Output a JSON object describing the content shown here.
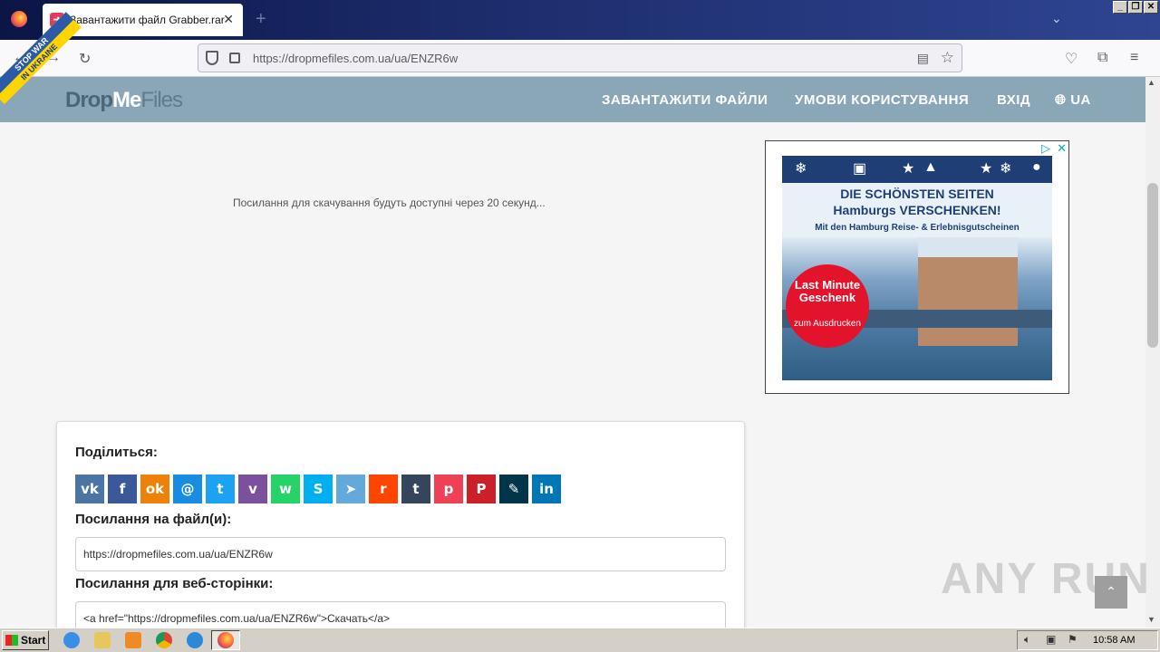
{
  "browser": {
    "tab_title": "Завантажити файл Grabber.rar",
    "new_tab": "+",
    "url_host": "https://dropmefiles.com.ua",
    "url_path": "/ua/ENZR6w"
  },
  "site": {
    "logo_drop": "Drop",
    "logo_me": "Me",
    "logo_files": "Files",
    "banner_line1": "STOP WAR",
    "banner_line2": "IN UKRAINE",
    "menu": {
      "upload": "ЗАВАНТАЖИТИ ФАЙЛИ",
      "terms": "УМОВИ КОРИСТУВАННЯ",
      "login": "ВХІД",
      "lang": "UA"
    }
  },
  "main": {
    "countdown_text": "Посилання для скачування будуть доступні через 20 секунд...",
    "share_label": "Поділиться:",
    "file_links_label": "Посилання на файл(и):",
    "file_link_value": "https://dropmefiles.com.ua/ua/ENZR6w",
    "web_label": "Посилання для веб-сторінки:",
    "web_code_value": "<a href=\"https://dropmefiles.com.ua/ua/ENZR6w\">Скачать</a>"
  },
  "social": [
    {
      "name": "vk",
      "glyph": "vk",
      "color": "#4c75a3"
    },
    {
      "name": "facebook",
      "glyph": "f",
      "color": "#3b5998"
    },
    {
      "name": "odnoklassniki",
      "glyph": "ok",
      "color": "#ee8208"
    },
    {
      "name": "mailru",
      "glyph": "@",
      "color": "#168de2"
    },
    {
      "name": "twitter",
      "glyph": "t",
      "color": "#1da1f2"
    },
    {
      "name": "viber",
      "glyph": "v",
      "color": "#7b519d"
    },
    {
      "name": "whatsapp",
      "glyph": "w",
      "color": "#25d366"
    },
    {
      "name": "skype",
      "glyph": "S",
      "color": "#00aff0"
    },
    {
      "name": "telegram",
      "glyph": "➤",
      "color": "#64a9dc"
    },
    {
      "name": "reddit",
      "glyph": "r",
      "color": "#ff4500"
    },
    {
      "name": "tumblr",
      "glyph": "t",
      "color": "#35465c"
    },
    {
      "name": "pocket",
      "glyph": "p",
      "color": "#ef4056"
    },
    {
      "name": "pinterest",
      "glyph": "P",
      "color": "#cb2027"
    },
    {
      "name": "livejournal",
      "glyph": "✎",
      "color": "#00354a"
    },
    {
      "name": "linkedin",
      "glyph": "in",
      "color": "#0077b5"
    }
  ],
  "ad": {
    "headline1": "DIE SCHÖNSTEN SEITEN",
    "headline2": "Hamburgs VERSCHENKEN!",
    "subline": "Mit den Hamburg Reise- & Erlebnisgutscheinen",
    "badge_main": "Last Minute Geschenk",
    "badge_sub": "zum Ausdrucken"
  },
  "watermark": "ANY RUN",
  "taskbar": {
    "start": "Start",
    "clock": "10:58 AM"
  }
}
